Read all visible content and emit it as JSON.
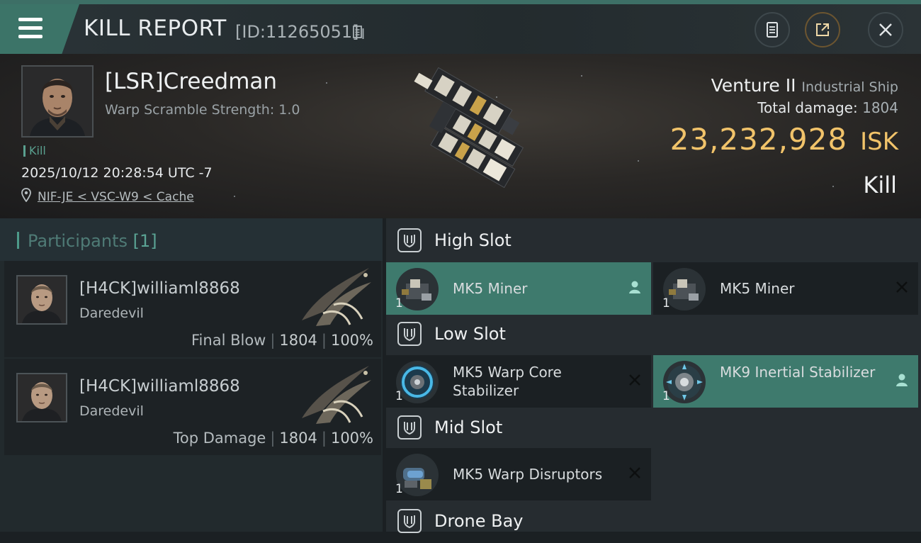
{
  "header": {
    "title": "KILL REPORT",
    "id_text": "[ID:11265051]"
  },
  "victim": {
    "name": "[LSR]Creedman",
    "scramble": "Warp Scramble Strength: 1.0",
    "kill_tag": "Kill",
    "timestamp": "2025/10/12 20:28:54 UTC -7",
    "location": "NIF-JE < VSC-W9 < Cache",
    "ship_name": "Venture II",
    "ship_class": "Industrial Ship",
    "total_damage_label": "Total damage:",
    "total_damage": "1804",
    "isk_value": "23,232,928",
    "isk_unit": "ISK",
    "result": "Kill"
  },
  "participants": {
    "title": "Participants",
    "count": "[1]",
    "rows": [
      {
        "name": "[H4CK]williaml8868",
        "ship": "Daredevil",
        "label": "Final Blow",
        "damage": "1804",
        "percent": "100%"
      },
      {
        "name": "[H4CK]williaml8868",
        "ship": "Daredevil",
        "label": "Top Damage",
        "damage": "1804",
        "percent": "100%"
      }
    ]
  },
  "slots": {
    "high": {
      "title": "High Slot",
      "modules": [
        {
          "name": "MK5 Miner",
          "qty": "1",
          "status": "person"
        },
        {
          "name": "MK5 Miner",
          "qty": "1",
          "status": "destroyed"
        }
      ]
    },
    "low": {
      "title": "Low Slot",
      "modules": [
        {
          "name": "MK5 Warp Core Stabilizer",
          "qty": "1",
          "status": "destroyed"
        },
        {
          "name": "MK9 Inertial Stabilizer",
          "qty": "1",
          "status": "person"
        }
      ]
    },
    "mid": {
      "title": "Mid Slot",
      "modules": [
        {
          "name": "MK5 Warp Disruptors",
          "qty": "1",
          "status": "destroyed"
        }
      ]
    },
    "drone": {
      "title": "Drone Bay"
    }
  },
  "colors": {
    "accent": "#3e7a6d",
    "isk_gold": "#f1c36a",
    "background": "#1b2023"
  },
  "icons": [
    "menu-icon",
    "copy-icon",
    "report-icon",
    "share-icon",
    "close-icon",
    "location-pin-icon",
    "slot-icon",
    "person-icon",
    "destroyed-x-icon"
  ]
}
